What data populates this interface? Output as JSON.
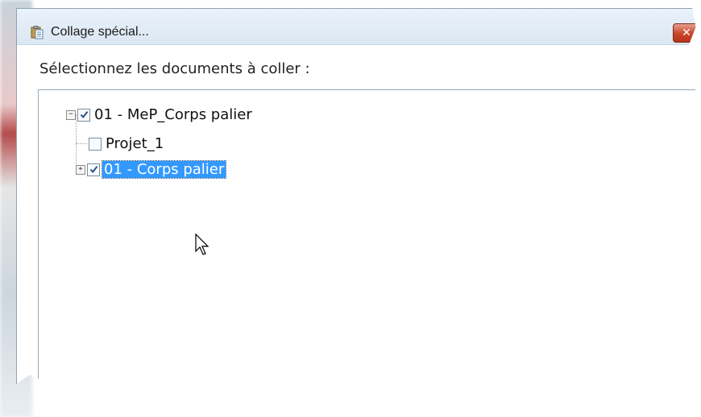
{
  "dialog": {
    "title": "Collage spécial...",
    "close_label": "✕",
    "prompt": "Sélectionnez les documents à coller :"
  },
  "tree": {
    "root": {
      "label": "01 - MeP_Corps palier",
      "checked": true,
      "expanded": true
    },
    "children": [
      {
        "label": "Projet_1",
        "checked": false,
        "expandable": false
      },
      {
        "label": "01 - Corps palier",
        "checked": true,
        "expandable": true,
        "selected": true
      }
    ]
  },
  "icons": {
    "title": "paste-clipboard-icon",
    "close": "close-icon",
    "cursor": "mouse-pointer-icon"
  },
  "colors": {
    "selection": "#3399ff",
    "close_button": "#c84a30"
  }
}
